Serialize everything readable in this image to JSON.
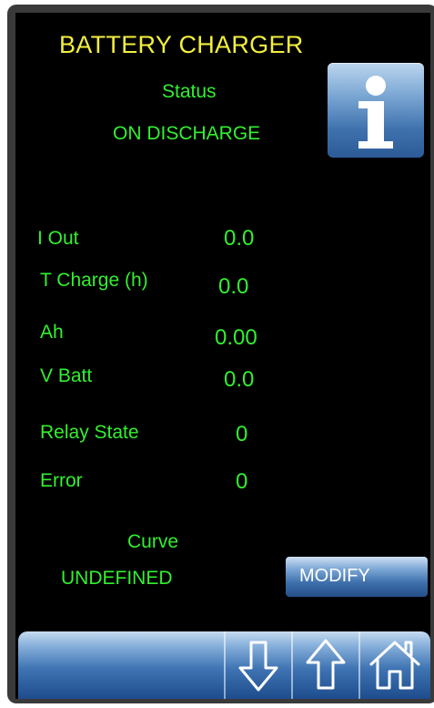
{
  "header": {
    "title": "BATTERY CHARGER"
  },
  "status": {
    "label": "Status",
    "value": "ON DISCHARGE"
  },
  "readings": [
    {
      "label": "I Out",
      "value": "0.0"
    },
    {
      "label": "T Charge (h)",
      "value": "0.0"
    },
    {
      "label": "Ah",
      "value": "0.00"
    },
    {
      "label": "V Batt",
      "value": "0.0"
    },
    {
      "label": "Relay State",
      "value": "0"
    },
    {
      "label": "Error",
      "value": "0"
    }
  ],
  "curve": {
    "label": "Curve",
    "value": "UNDEFINED"
  },
  "buttons": {
    "modify_label": "MODIFY",
    "info_icon": "info-icon"
  },
  "nav": {
    "icons": [
      "arrow-down-icon",
      "arrow-up-icon",
      "home-icon"
    ]
  },
  "colors": {
    "title": "#f3ef3e",
    "text": "#32f02f",
    "background": "#000000",
    "button": "#3f72ad"
  }
}
